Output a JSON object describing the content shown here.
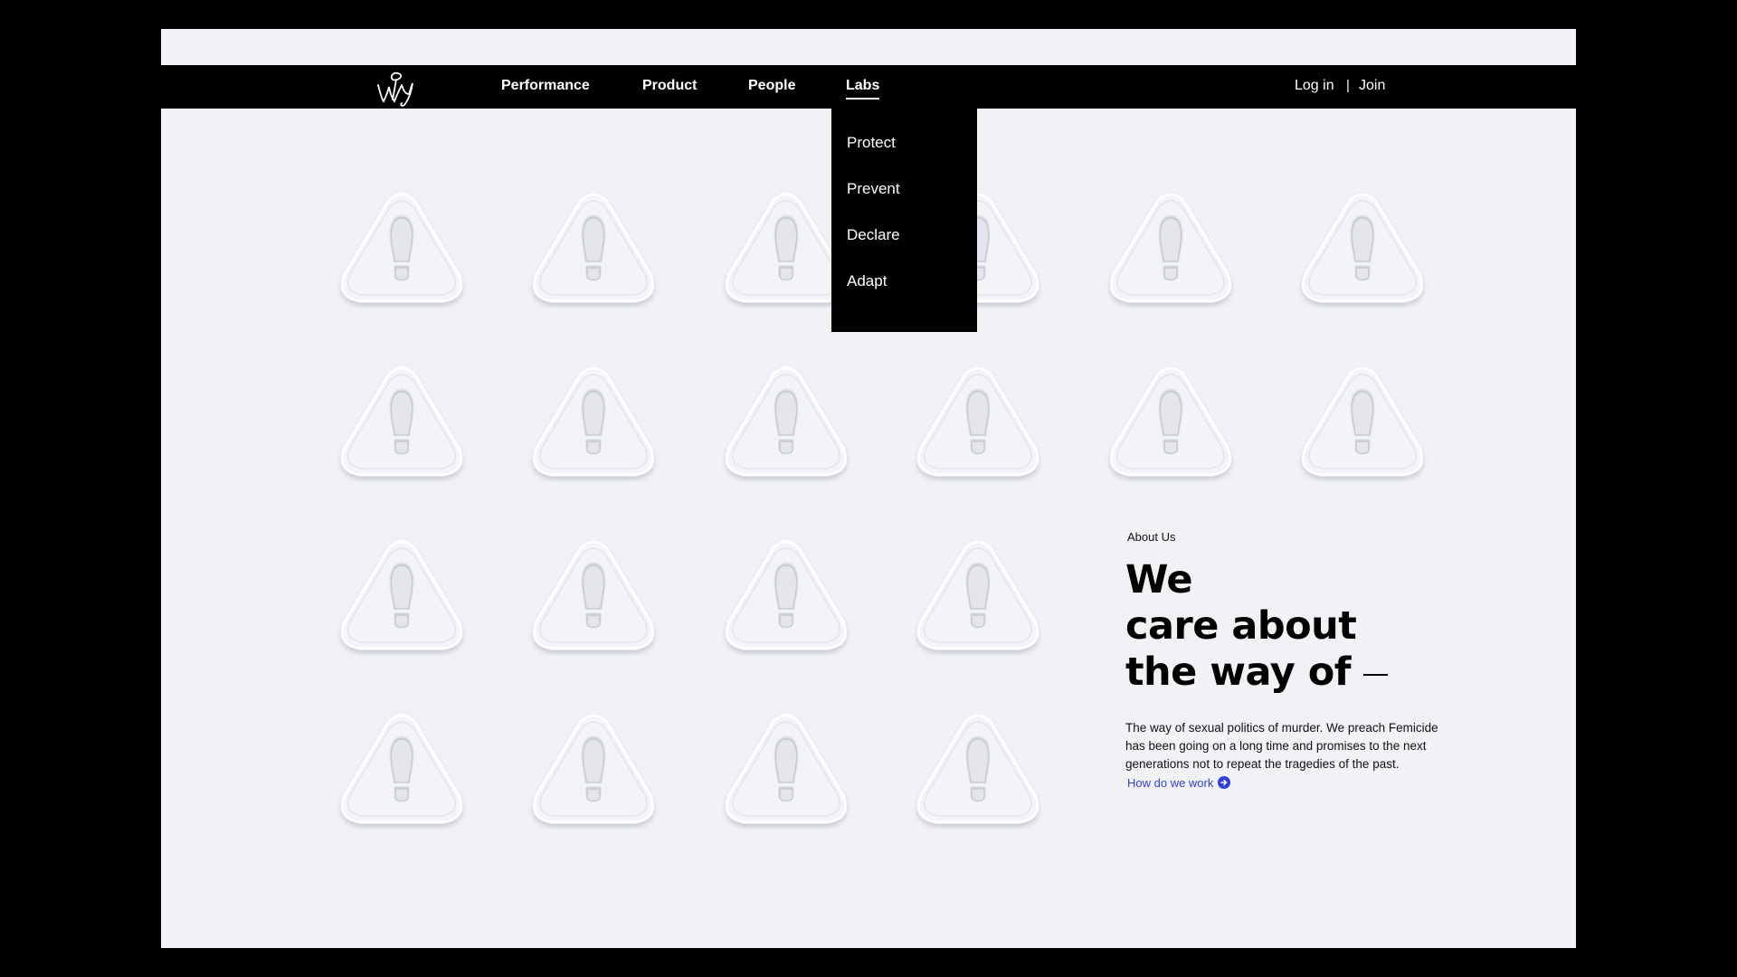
{
  "nav": {
    "logo_text": "wy",
    "items": [
      {
        "label": "Performance"
      },
      {
        "label": "Product"
      },
      {
        "label": "People"
      },
      {
        "label": "Labs",
        "active": true
      }
    ],
    "login_label": "Log in",
    "separator": "|",
    "join_label": "Join"
  },
  "labs_dropdown": {
    "items": [
      "Protect",
      "Prevent",
      "Declare",
      "Adapt"
    ]
  },
  "grid": {
    "icon": "warning-footprint-icon",
    "tile_count": 22
  },
  "about": {
    "label": "About Us",
    "headline_lines": [
      "We",
      "care about",
      "the way of"
    ],
    "body": "The way of sexual politics of murder. We preach Femicide has been going on a long time and promises to the next generations not to repeat the tragedies of the past.",
    "cta_label": "How do we work",
    "cta_icon": "arrow-circle-icon",
    "cta_color": "#2f3ee0"
  },
  "colors": {
    "page_background": "#f1f2f6",
    "nav_background": "#000000",
    "outer_background": "#000000"
  }
}
